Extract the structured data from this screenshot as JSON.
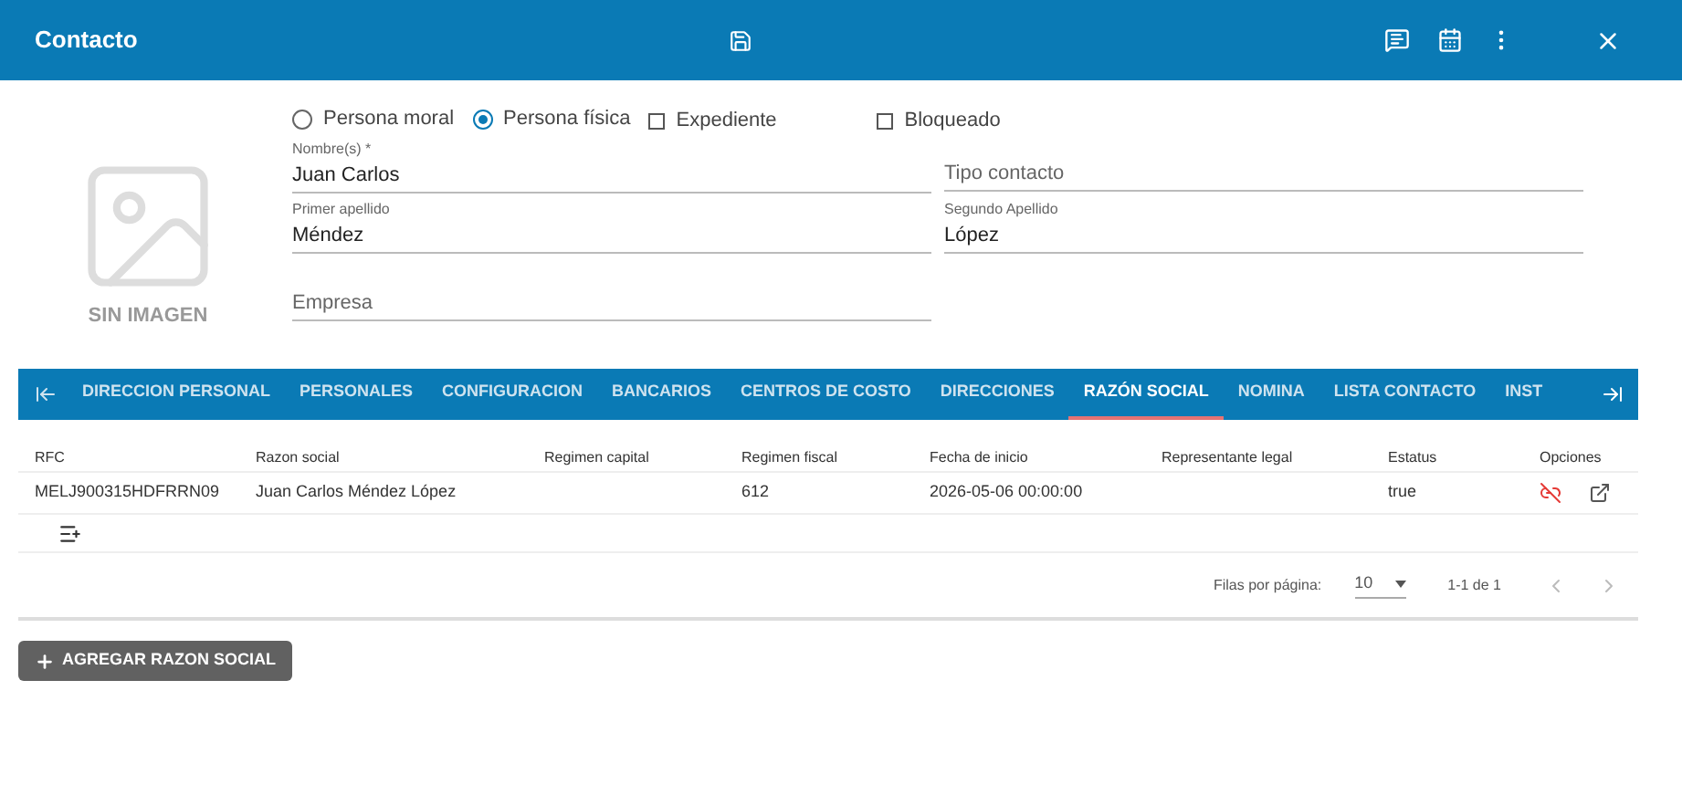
{
  "window": {
    "title": "Contacto"
  },
  "placeholder_image": {
    "caption": "SIN IMAGEN"
  },
  "person_type": [
    {
      "label": "Persona moral",
      "selected": false
    },
    {
      "label": "Persona física",
      "selected": true
    }
  ],
  "flags": [
    {
      "label": "Expediente",
      "checked": false
    },
    {
      "label": "Bloqueado",
      "checked": false
    }
  ],
  "fields": [
    {
      "label": "Nombre(s) *",
      "value": "Juan Carlos"
    },
    {
      "placeholder": "Tipo contacto"
    },
    {
      "label": "Primer apellido",
      "value": "Méndez"
    },
    {
      "label": "Segundo Apellido",
      "value": "López"
    },
    {
      "placeholder": "Empresa"
    }
  ],
  "tabs": [
    {
      "label": "DIRECCION PERSONAL",
      "selected": false
    },
    {
      "label": "PERSONALES",
      "selected": false
    },
    {
      "label": "CONFIGURACION",
      "selected": false
    },
    {
      "label": "BANCARIOS",
      "selected": false
    },
    {
      "label": "CENTROS DE COSTO",
      "selected": false
    },
    {
      "label": "DIRECCIONES",
      "selected": false
    },
    {
      "label": "RAZÓN SOCIAL",
      "selected": true
    },
    {
      "label": "NOMINA",
      "selected": false
    },
    {
      "label": "LISTA CONTACTO",
      "selected": false
    },
    {
      "label": "INST",
      "selected": false
    }
  ],
  "table": {
    "columns": [
      "RFC",
      "Razon social",
      "Regimen capital",
      "Regimen fiscal",
      "Fecha de inicio",
      "Representante legal",
      "Estatus",
      "Opciones"
    ],
    "rows": [
      [
        "MELJ900315HDFRRN09",
        "Juan Carlos Méndez López",
        "",
        "612",
        "2026-05-06 00:00:00",
        "",
        "true"
      ]
    ]
  },
  "pagination": {
    "rows_label": "Filas por página:",
    "rows_value": "10",
    "range": "1-1 de 1"
  },
  "add_button": "AGREGAR RAZON SOCIAL"
}
